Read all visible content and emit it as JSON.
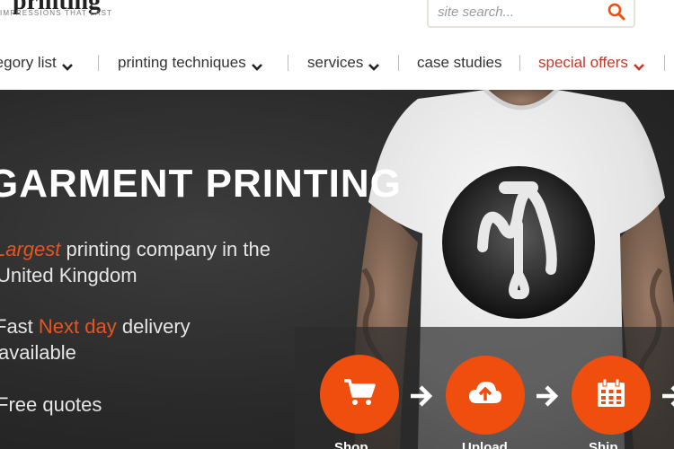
{
  "brand": {
    "name": "printing",
    "tagline": "impressions that last"
  },
  "search": {
    "placeholder": "site search..."
  },
  "nav": {
    "items": [
      {
        "label": "category list"
      },
      {
        "label": "printing techniques"
      },
      {
        "label": "services"
      },
      {
        "label": "case studies"
      },
      {
        "label": "special offers"
      }
    ]
  },
  "hero": {
    "title": "GARMENT PRINTING",
    "line1_accent": "Largest",
    "line1_rest": " printing company in the",
    "line2": "United Kingdom",
    "line3_pre": "Fast ",
    "line3_accent": "Next day",
    "line3_post": " delivery",
    "line4": "available",
    "line5": "Free quotes"
  },
  "steps": [
    {
      "icon": "shopping-cart-icon",
      "label": "Shop"
    },
    {
      "icon": "cloud-upload-icon",
      "label": "Upload"
    },
    {
      "icon": "calendar-icon",
      "label": "Ship"
    }
  ],
  "colors": {
    "accent": "#f04e0e",
    "special_offers": "#c0392b",
    "hero_bg": "#2a2a2a"
  }
}
